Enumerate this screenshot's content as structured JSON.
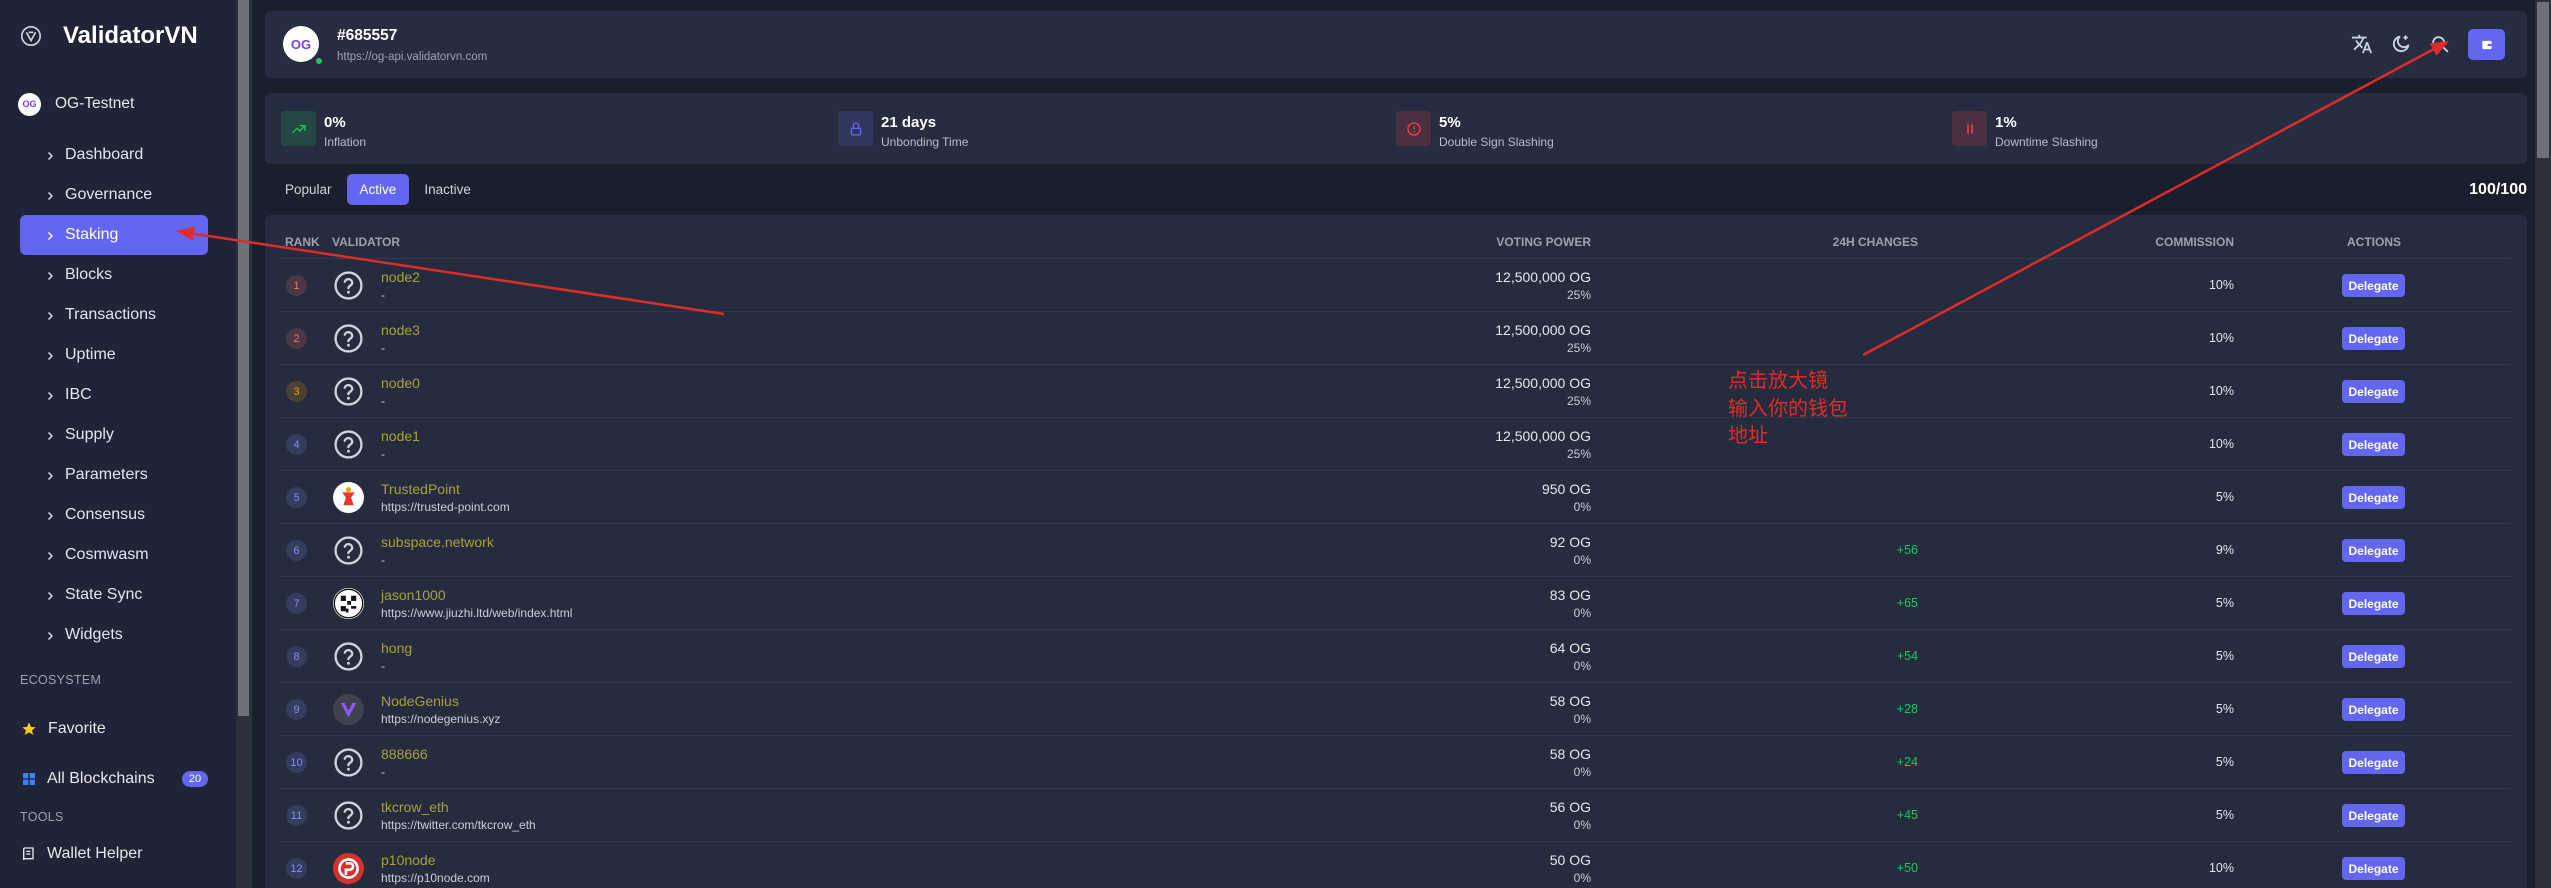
{
  "colors": {
    "accent": "#6366f1",
    "name": "#a8a13b",
    "positive": "#22c55e",
    "online": "#22c55e",
    "annotation": "#e02b2b"
  },
  "sidebar": {
    "brand": "ValidatorVN",
    "brand_icon": "validatorvn-logo-icon",
    "chain_logo": "OG",
    "chain": "OG-Testnet",
    "menu": [
      {
        "label": "Dashboard"
      },
      {
        "label": "Governance"
      },
      {
        "label": "Staking"
      },
      {
        "label": "Blocks"
      },
      {
        "label": "Transactions"
      },
      {
        "label": "Uptime"
      },
      {
        "label": "IBC"
      },
      {
        "label": "Supply"
      },
      {
        "label": "Parameters"
      },
      {
        "label": "Consensus"
      },
      {
        "label": "Cosmwasm"
      },
      {
        "label": "State Sync"
      },
      {
        "label": "Widgets"
      }
    ],
    "active_index": 2,
    "ecosystem_heading": "ECOSYSTEM",
    "favorite": "Favorite",
    "all_blockchains": "All Blockchains",
    "all_blockchains_count": "20",
    "tools_heading": "TOOLS",
    "wallet_helper": "Wallet Helper"
  },
  "header": {
    "logo_text": "OG",
    "block_height": "#685557",
    "endpoint": "https://og-api.validatorvn.com",
    "action_icons": [
      "translate-icon",
      "moon-icon",
      "search-icon",
      "wallet-icon"
    ]
  },
  "stats": [
    {
      "value": "0%",
      "label": "Inflation",
      "icon": "trending-up-icon",
      "color": "#22c55e"
    },
    {
      "value": "21 days",
      "label": "Unbonding Time",
      "icon": "lock-icon",
      "color": "#6366f1"
    },
    {
      "value": "5%",
      "label": "Double Sign Slashing",
      "icon": "alert-circle-icon",
      "color": "#ef4444"
    },
    {
      "value": "1%",
      "label": "Downtime Slashing",
      "icon": "pause-icon",
      "color": "#ef4444"
    }
  ],
  "tabs": {
    "items": [
      {
        "label": "Popular"
      },
      {
        "label": "Active"
      },
      {
        "label": "Inactive"
      }
    ],
    "active_index": 1,
    "count": "100/100"
  },
  "table": {
    "columns": {
      "rank": "RANK",
      "validator": "VALIDATOR",
      "voting_power": "VOTING POWER",
      "changes": "24H CHANGES",
      "commission": "COMMISSION",
      "actions": "ACTIONS"
    },
    "delegate_label": "Delegate",
    "rows": [
      {
        "rank": "1",
        "rank_color": "#f87171",
        "avatar": "question-icon",
        "name": "node2",
        "website": "-",
        "voting_power": "12,500,000 OG",
        "share": "25%",
        "change": "",
        "commission": "10%"
      },
      {
        "rank": "2",
        "rank_color": "#f87171",
        "avatar": "question-icon",
        "name": "node3",
        "website": "-",
        "voting_power": "12,500,000 OG",
        "share": "25%",
        "change": "",
        "commission": "10%"
      },
      {
        "rank": "3",
        "rank_color": "#f59e0b",
        "avatar": "question-icon",
        "name": "node0",
        "website": "-",
        "voting_power": "12,500,000 OG",
        "share": "25%",
        "change": "",
        "commission": "10%"
      },
      {
        "rank": "4",
        "rank_color": "#818cf8",
        "avatar": "question-icon",
        "name": "node1",
        "website": "-",
        "voting_power": "12,500,000 OG",
        "share": "25%",
        "change": "",
        "commission": "10%"
      },
      {
        "rank": "5",
        "rank_color": "#818cf8",
        "avatar": "trustedpoint-logo-icon",
        "name": "TrustedPoint",
        "website": "https://trusted-point.com",
        "voting_power": "950 OG",
        "share": "0%",
        "change": "",
        "commission": "5%"
      },
      {
        "rank": "6",
        "rank_color": "#818cf8",
        "avatar": "question-icon",
        "name": "subspace.network",
        "website": "-",
        "voting_power": "92 OG",
        "share": "0%",
        "change": "+56",
        "commission": "9%"
      },
      {
        "rank": "7",
        "rank_color": "#818cf8",
        "avatar": "jason1000-avatar-icon",
        "name": "jason1000",
        "website": "https://www.jiuzhi.ltd/web/index.html",
        "voting_power": "83 OG",
        "share": "0%",
        "change": "+65",
        "commission": "5%"
      },
      {
        "rank": "8",
        "rank_color": "#818cf8",
        "avatar": "question-icon",
        "name": "hong",
        "website": "-",
        "voting_power": "64 OG",
        "share": "0%",
        "change": "+54",
        "commission": "5%"
      },
      {
        "rank": "9",
        "rank_color": "#818cf8",
        "avatar": "nodegenius-logo-icon",
        "name": "NodeGenius",
        "website": "https://nodegenius.xyz",
        "voting_power": "58 OG",
        "share": "0%",
        "change": "+28",
        "commission": "5%"
      },
      {
        "rank": "10",
        "rank_color": "#818cf8",
        "avatar": "question-icon",
        "name": "888666",
        "website": "-",
        "voting_power": "58 OG",
        "share": "0%",
        "change": "+24",
        "commission": "5%"
      },
      {
        "rank": "11",
        "rank_color": "#818cf8",
        "avatar": "question-icon",
        "name": "tkcrow_eth",
        "website": "https://twitter.com/tkcrow_eth",
        "voting_power": "56 OG",
        "share": "0%",
        "change": "+45",
        "commission": "5%"
      },
      {
        "rank": "12",
        "rank_color": "#818cf8",
        "avatar": "p10node-logo-icon",
        "name": "p10node",
        "website": "https://p10node.com",
        "voting_power": "50 OG",
        "share": "0%",
        "change": "+50",
        "commission": "10%"
      }
    ]
  },
  "annotation": {
    "lines": [
      "点击放大镜",
      "输入你的钱包",
      "地址"
    ]
  }
}
